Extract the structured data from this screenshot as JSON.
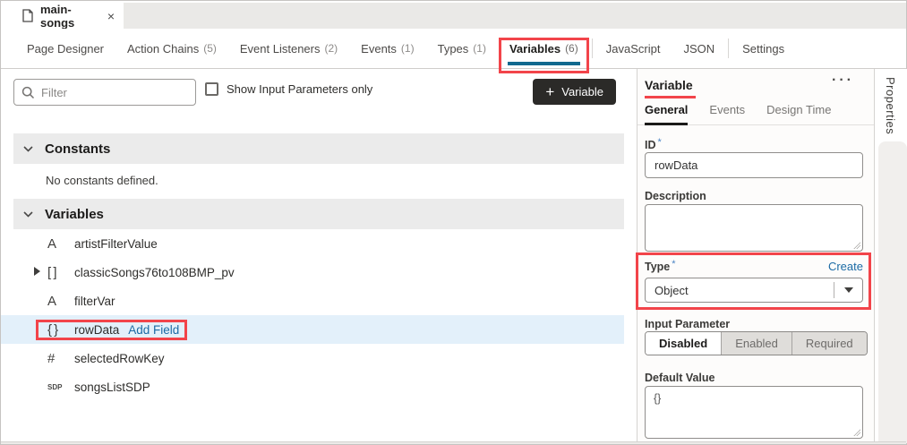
{
  "tab_bar": {
    "active_tab": "main-songs",
    "close_icon": "×"
  },
  "nav": {
    "tabs": [
      {
        "label": "Page Designer",
        "count": ""
      },
      {
        "label": "Action Chains",
        "count": "(5)"
      },
      {
        "label": "Event Listeners",
        "count": "(2)"
      },
      {
        "label": "Events",
        "count": "(1)"
      },
      {
        "label": "Types",
        "count": "(1)"
      },
      {
        "label": "Variables",
        "count": "(6)",
        "active": true
      },
      {
        "label": "JavaScript",
        "count": ""
      },
      {
        "label": "JSON",
        "count": ""
      },
      {
        "label": "Settings",
        "count": ""
      }
    ]
  },
  "left_panel": {
    "filter_placeholder": "Filter",
    "show_input_parameters_label": "Show Input Parameters only",
    "add_variable_button": {
      "plus": "+",
      "label": "Variable"
    },
    "constants_section": {
      "title": "Constants",
      "empty_message": "No constants defined."
    },
    "variables_section": {
      "title": "Variables"
    },
    "variables": [
      {
        "icon": "string-type-icon",
        "glyph": "A",
        "name": "artistFilterValue"
      },
      {
        "icon": "array-type-icon",
        "glyph": "[ ]",
        "name": "classicSongs76to108BMP_pv",
        "expandable": true
      },
      {
        "icon": "string-type-icon",
        "glyph": "A",
        "name": "filterVar"
      },
      {
        "icon": "object-type-icon",
        "glyph": "{ }",
        "name": "rowData",
        "action": "Add Field",
        "selected": true
      },
      {
        "icon": "number-type-icon",
        "glyph": "#",
        "name": "selectedRowKey"
      },
      {
        "icon": "sdp-type-icon",
        "glyph": "SDP",
        "name": "songsListSDP"
      }
    ]
  },
  "properties_panel": {
    "title": "Variable",
    "overflow_menu": "···",
    "tabs": [
      {
        "label": "General",
        "active": true
      },
      {
        "label": "Events"
      },
      {
        "label": "Design Time"
      }
    ],
    "fields": {
      "id": {
        "label": "ID",
        "required": "*",
        "value": "rowData"
      },
      "description": {
        "label": "Description",
        "value": ""
      },
      "type": {
        "label": "Type",
        "required": "*",
        "link": "Create",
        "value": "Object"
      },
      "input_parameter": {
        "label": "Input Parameter",
        "options": [
          "Disabled",
          "Enabled",
          "Required"
        ],
        "selected": "Disabled"
      },
      "default_value": {
        "label": "Default Value",
        "value": "{}"
      }
    }
  },
  "right_rail": {
    "label": "Properties"
  },
  "colors": {
    "annotation_red": "#f2444a",
    "active_nav_underline": "#11698e",
    "link_blue": "#1c6ba5",
    "selected_row_bg": "#e3f0fa",
    "dark_button_bg": "#2b2a28",
    "section_bar_bg": "#ebebeb"
  }
}
